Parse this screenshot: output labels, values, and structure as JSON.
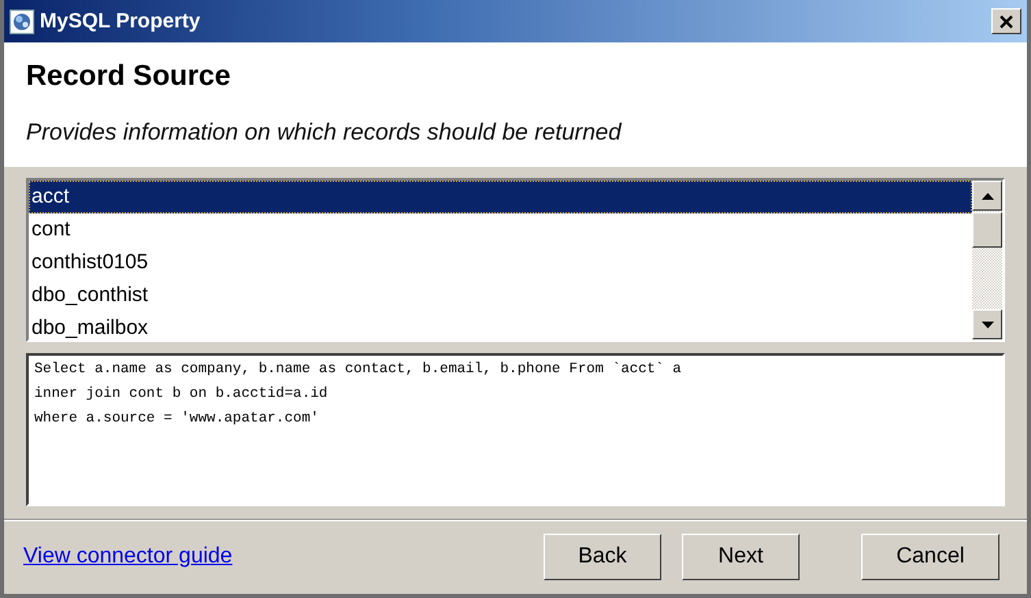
{
  "window": {
    "title": "MySQL Property"
  },
  "header": {
    "title": "Record Source",
    "subtitle": "Provides information on which records should be returned"
  },
  "tables": [
    {
      "label": "acct",
      "selected": true
    },
    {
      "label": "cont",
      "selected": false
    },
    {
      "label": "conthist0105",
      "selected": false
    },
    {
      "label": "dbo_conthist",
      "selected": false
    },
    {
      "label": "dbo_mailbox",
      "selected": false
    }
  ],
  "query": {
    "value": "Select a.name as company, b.name as contact, b.email, b.phone From `acct` a\ninner join cont b on b.acctid=a.id\nwhere a.source = 'www.apatar.com'"
  },
  "link": "View connector guide",
  "buttons": [
    "Back",
    "Next",
    "Cancel"
  ]
}
